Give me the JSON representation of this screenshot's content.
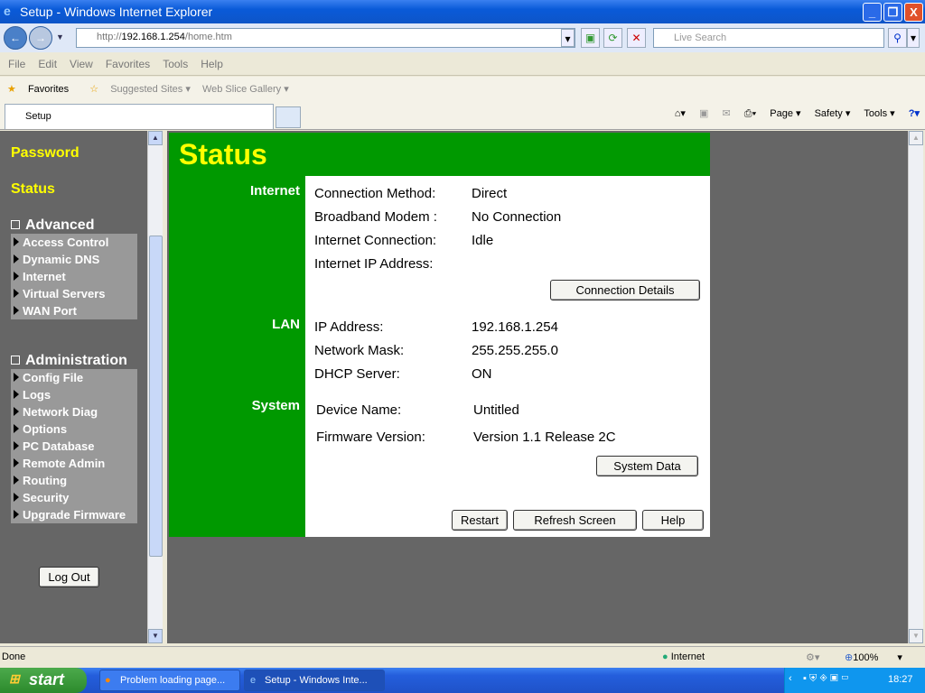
{
  "window": {
    "title": "Setup - Windows Internet Explorer",
    "min": "_",
    "max": "❐",
    "close": "X"
  },
  "address": {
    "prefix": "http://",
    "host": "192.168.1.254",
    "path": "/home.htm"
  },
  "search": {
    "placeholder": "Live Search"
  },
  "menu": [
    "File",
    "Edit",
    "View",
    "Favorites",
    "Tools",
    "Help"
  ],
  "favorites": {
    "label": "Favorites",
    "items": [
      "Suggested Sites ▾",
      "Web Slice Gallery ▾"
    ]
  },
  "tab": {
    "label": "Setup"
  },
  "commandbar": [
    "Page ▾",
    "Safety ▾",
    "Tools ▾"
  ],
  "sidebar": {
    "password": "Password",
    "status": "Status",
    "advanced": {
      "title": "Advanced",
      "items": [
        "Access Control",
        "Dynamic DNS",
        "Internet",
        "Virtual Servers",
        "WAN Port"
      ]
    },
    "administration": {
      "title": "Administration",
      "items": [
        "Config File",
        "Logs",
        "Network Diag",
        "Options",
        "PC Database",
        "Remote Admin",
        "Routing",
        "Security",
        "Upgrade Firmware"
      ]
    },
    "logout": "Log Out"
  },
  "status": {
    "title": "Status",
    "internet": {
      "label": "Internet",
      "rows": [
        [
          "Connection Method:",
          "Direct"
        ],
        [
          "Broadband Modem :",
          "No Connection"
        ],
        [
          "Internet Connection:",
          "Idle"
        ],
        [
          "Internet IP Address:",
          ""
        ]
      ],
      "button": "Connection Details"
    },
    "lan": {
      "label": "LAN",
      "rows": [
        [
          "IP Address:",
          "192.168.1.254"
        ],
        [
          "Network Mask:",
          "255.255.255.0"
        ],
        [
          "DHCP Server:",
          "ON"
        ]
      ]
    },
    "system": {
      "label": "System",
      "rows": [
        [
          "Device Name:",
          "Untitled"
        ],
        [
          "Firmware Version:",
          "Version 1.1 Release 2C"
        ]
      ],
      "button": "System Data"
    },
    "buttons": {
      "restart": "Restart",
      "refresh": "Refresh Screen",
      "help": "Help"
    }
  },
  "statusbar": {
    "text": "Done",
    "zone": "Internet",
    "zoom": "100%"
  },
  "taskbar": {
    "start": "start",
    "tasks": [
      "Problem loading page...",
      "Setup - Windows Inte..."
    ],
    "clock": "18:27"
  },
  "colors": {
    "panel_green": "#009900",
    "title_yellow": "#ffff00"
  }
}
